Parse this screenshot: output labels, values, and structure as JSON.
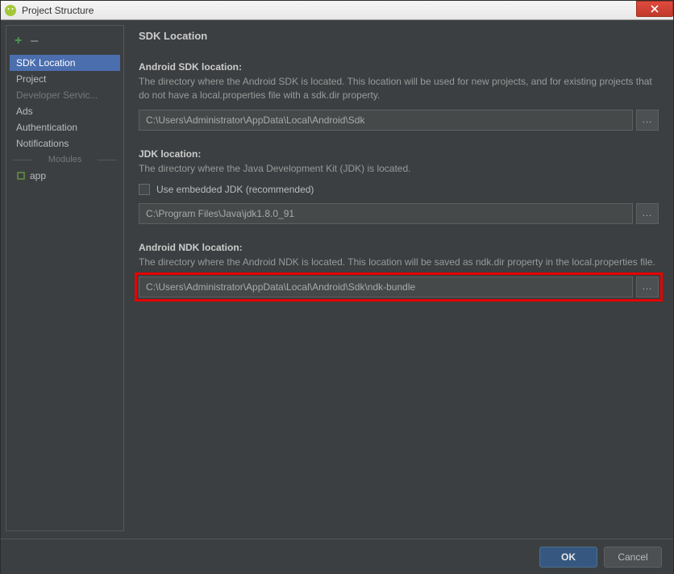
{
  "window": {
    "title": "Project Structure"
  },
  "sidebar": {
    "items": [
      {
        "label": "SDK Location",
        "selected": true
      },
      {
        "label": "Project"
      },
      {
        "label": "Developer Servic...",
        "dim": true
      },
      {
        "label": "Ads"
      },
      {
        "label": "Authentication"
      },
      {
        "label": "Notifications"
      }
    ],
    "modules_header": "Modules",
    "modules": [
      {
        "label": "app"
      }
    ]
  },
  "main": {
    "title": "SDK Location",
    "sdk": {
      "label": "Android SDK location:",
      "desc": "The directory where the Android SDK is located. This location will be used for new projects, and for existing projects that do not have a local.properties file with a sdk.dir property.",
      "path": "C:\\Users\\Administrator\\AppData\\Local\\Android\\Sdk"
    },
    "jdk": {
      "label": "JDK location:",
      "desc": "The directory where the Java Development Kit (JDK) is located.",
      "checkbox_label": "Use embedded JDK (recommended)",
      "path": "C:\\Program Files\\Java\\jdk1.8.0_91"
    },
    "ndk": {
      "label": "Android NDK location:",
      "desc": "The directory where the Android NDK is located. This location will be saved as ndk.dir property in the local.properties file.",
      "path": "C:\\Users\\Administrator\\AppData\\Local\\Android\\Sdk\\ndk-bundle"
    },
    "browse_label": "..."
  },
  "footer": {
    "ok": "OK",
    "cancel": "Cancel"
  }
}
